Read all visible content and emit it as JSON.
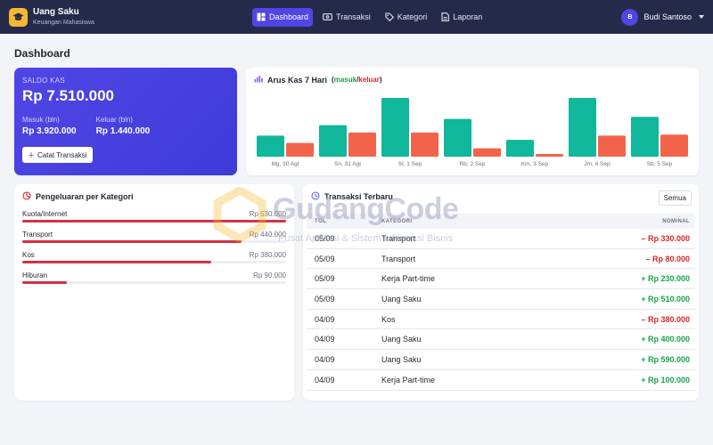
{
  "app": {
    "title": "Uang Saku",
    "subtitle": "Keuangan Mahasiswa"
  },
  "nav": [
    {
      "label": "Dashboard",
      "icon": "dashboard-icon",
      "active": true
    },
    {
      "label": "Transaksi",
      "icon": "wallet-icon",
      "active": false
    },
    {
      "label": "Kategori",
      "icon": "tag-icon",
      "active": false
    },
    {
      "label": "Laporan",
      "icon": "report-icon",
      "active": false
    }
  ],
  "user": {
    "initial": "B",
    "name": "Budi Santoso"
  },
  "page": {
    "title": "Dashboard"
  },
  "saldo": {
    "label": "SALDO KAS",
    "value": "Rp 7.510.000",
    "masuk_label": "Masuk (bln)",
    "masuk_value": "Rp 3.920.000",
    "keluar_label": "Keluar (bln)",
    "keluar_value": "Rp 1.440.000",
    "button_label": "Catat Transaksi"
  },
  "arus": {
    "title": "Arus Kas 7 Hari",
    "paren_open": "(",
    "masuk": "masuk",
    "slash": "/",
    "keluar": "keluar",
    "paren_close": ")"
  },
  "chart_data": {
    "type": "bar",
    "categories": [
      "Mg, 30 Agt",
      "Sn, 31 Agt",
      "Sl, 1 Sep",
      "Rb, 2 Sep",
      "Km, 3 Sep",
      "Jm, 4 Sep",
      "Sb, 5 Sep"
    ],
    "series": [
      {
        "name": "masuk",
        "color": "#10b79a",
        "values": [
          200000,
          300000,
          560000,
          360000,
          160000,
          560000,
          380000
        ]
      },
      {
        "name": "keluar",
        "color": "#f26449",
        "values": [
          130000,
          230000,
          230000,
          80000,
          25000,
          200000,
          210000
        ]
      }
    ],
    "ylim": [
      0,
      560000
    ]
  },
  "pengeluaran": {
    "title": "Pengeluaran per Kategori",
    "items": [
      {
        "name": "Kuota/Internet",
        "amount": "Rp 530.000",
        "value": 530000
      },
      {
        "name": "Transport",
        "amount": "Rp 440.000",
        "value": 440000
      },
      {
        "name": "Kos",
        "amount": "Rp 380.000",
        "value": 380000
      },
      {
        "name": "Hiburan",
        "amount": "Rp 90.000",
        "value": 90000
      }
    ],
    "max": 530000
  },
  "transaksi": {
    "title": "Transaksi Terbaru",
    "button_label": "Semua",
    "headers": {
      "tgl": "TGL",
      "kategori": "KATEGORI",
      "nominal": "NOMINAL"
    },
    "rows": [
      {
        "tgl": "05/09",
        "kategori": "Transport",
        "nominal": "– Rp 330.000",
        "type": "neg"
      },
      {
        "tgl": "05/09",
        "kategori": "Transport",
        "nominal": "– Rp 80.000",
        "type": "neg"
      },
      {
        "tgl": "05/09",
        "kategori": "Kerja Part-time",
        "nominal": "+ Rp 230.000",
        "type": "pos"
      },
      {
        "tgl": "05/09",
        "kategori": "Uang Saku",
        "nominal": "+ Rp 510.000",
        "type": "pos"
      },
      {
        "tgl": "04/09",
        "kategori": "Kos",
        "nominal": "– Rp 380.000",
        "type": "neg"
      },
      {
        "tgl": "04/09",
        "kategori": "Uang Saku",
        "nominal": "+ Rp 400.000",
        "type": "pos"
      },
      {
        "tgl": "04/09",
        "kategori": "Uang Saku",
        "nominal": "+ Rp 590.000",
        "type": "pos"
      },
      {
        "tgl": "04/09",
        "kategori": "Kerja Part-time",
        "nominal": "+ Rp 100.000",
        "type": "pos"
      }
    ]
  },
  "watermark": {
    "title": "GudangCode",
    "subtitle": "Pusat Aplikasi & Sistem Informasi Bisnis"
  }
}
